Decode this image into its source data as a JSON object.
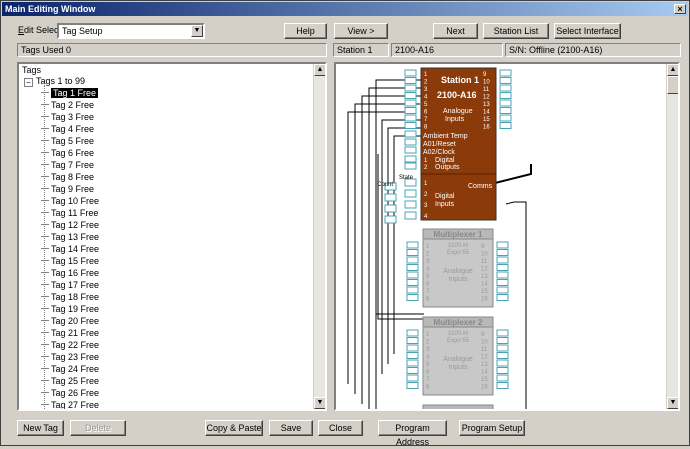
{
  "window": {
    "title": "Main Editing Window",
    "close": "×"
  },
  "edit_select": {
    "label_underlined": "E",
    "label_rest": "dit Select",
    "value": "Tag Setup",
    "arrow": "▼"
  },
  "top_buttons": {
    "help": "Help",
    "view": "View >",
    "next": "Next",
    "station_list": "Station List",
    "select_interface": "Select Interface"
  },
  "status": {
    "tags_used": "Tags Used 0",
    "station": "Station 1",
    "model": "2100-A16",
    "serial": "S/N: Offline (2100-A16)"
  },
  "tree": {
    "root": "Tags",
    "group": "Tags 1 to 99",
    "expander": "−",
    "items": [
      "Tag 1 Free",
      "Tag 2 Free",
      "Tag 3 Free",
      "Tag 4 Free",
      "Tag 5 Free",
      "Tag 6 Free",
      "Tag 7 Free",
      "Tag 8 Free",
      "Tag 9 Free",
      "Tag 10 Free",
      "Tag 11 Free",
      "Tag 12 Free",
      "Tag 13 Free",
      "Tag 14 Free",
      "Tag 15 Free",
      "Tag 16 Free",
      "Tag 17 Free",
      "Tag 18 Free",
      "Tag 19 Free",
      "Tag 20 Free",
      "Tag 21 Free",
      "Tag 22 Free",
      "Tag 23 Free",
      "Tag 24 Free",
      "Tag 25 Free",
      "Tag 26 Free",
      "Tag 27 Free"
    ]
  },
  "station": {
    "name": "Station 1",
    "model": "2100-A16",
    "inputs_line1": "Analogue",
    "inputs_line2": "Inputs",
    "left_pins": [
      "1",
      "2",
      "3",
      "4",
      "5",
      "6",
      "7",
      "8"
    ],
    "right_pins": [
      "9",
      "10",
      "11",
      "12",
      "13",
      "14",
      "15",
      "16"
    ],
    "ambient": "Ambient Temp",
    "a01": "A01/Reset",
    "a02": "A02/Clock",
    "dout_pins": [
      "1",
      "2"
    ],
    "dout_line1": "Digital",
    "dout_line2": "Outputs",
    "din_pins": [
      "1",
      "2",
      "3",
      "4"
    ],
    "din_line1": "Digital",
    "din_line2": "Inputs",
    "comms": "Comms",
    "count_label": "Count",
    "state_label": "State",
    "color": "#8b3a0a"
  },
  "multiplexers": [
    {
      "name": "Multiplexer 1",
      "model_line1": "2100-M",
      "model_line2": "Expo 55",
      "inputs_line1": "Analogue",
      "inputs_line2": "Inputs"
    },
    {
      "name": "Multiplexer 2",
      "model_line1": "2100-M",
      "model_line2": "Expo 55",
      "inputs_line1": "Analogue",
      "inputs_line2": "Inputs"
    }
  ],
  "mux_left_pins": [
    "1",
    "2",
    "3",
    "4",
    "5",
    "6",
    "7",
    "8"
  ],
  "mux_right_pins": [
    "9",
    "10",
    "11",
    "12",
    "13",
    "14",
    "15",
    "16"
  ],
  "bottom_buttons": {
    "new_tag": "New Tag",
    "delete": "Delete",
    "copy_paste": "Copy & Paste",
    "save": "Save",
    "close": "Close",
    "program_address": "Program Address",
    "program_setup": "Program Setup"
  },
  "scroll": {
    "up": "▲",
    "down": "▼"
  },
  "colors": {
    "title_start": "#0a246a",
    "title_end": "#a6caf0",
    "station_block": "#8b3a0a",
    "mux_block": "#c8c8c8",
    "pin_box": "#4aa3b5"
  }
}
